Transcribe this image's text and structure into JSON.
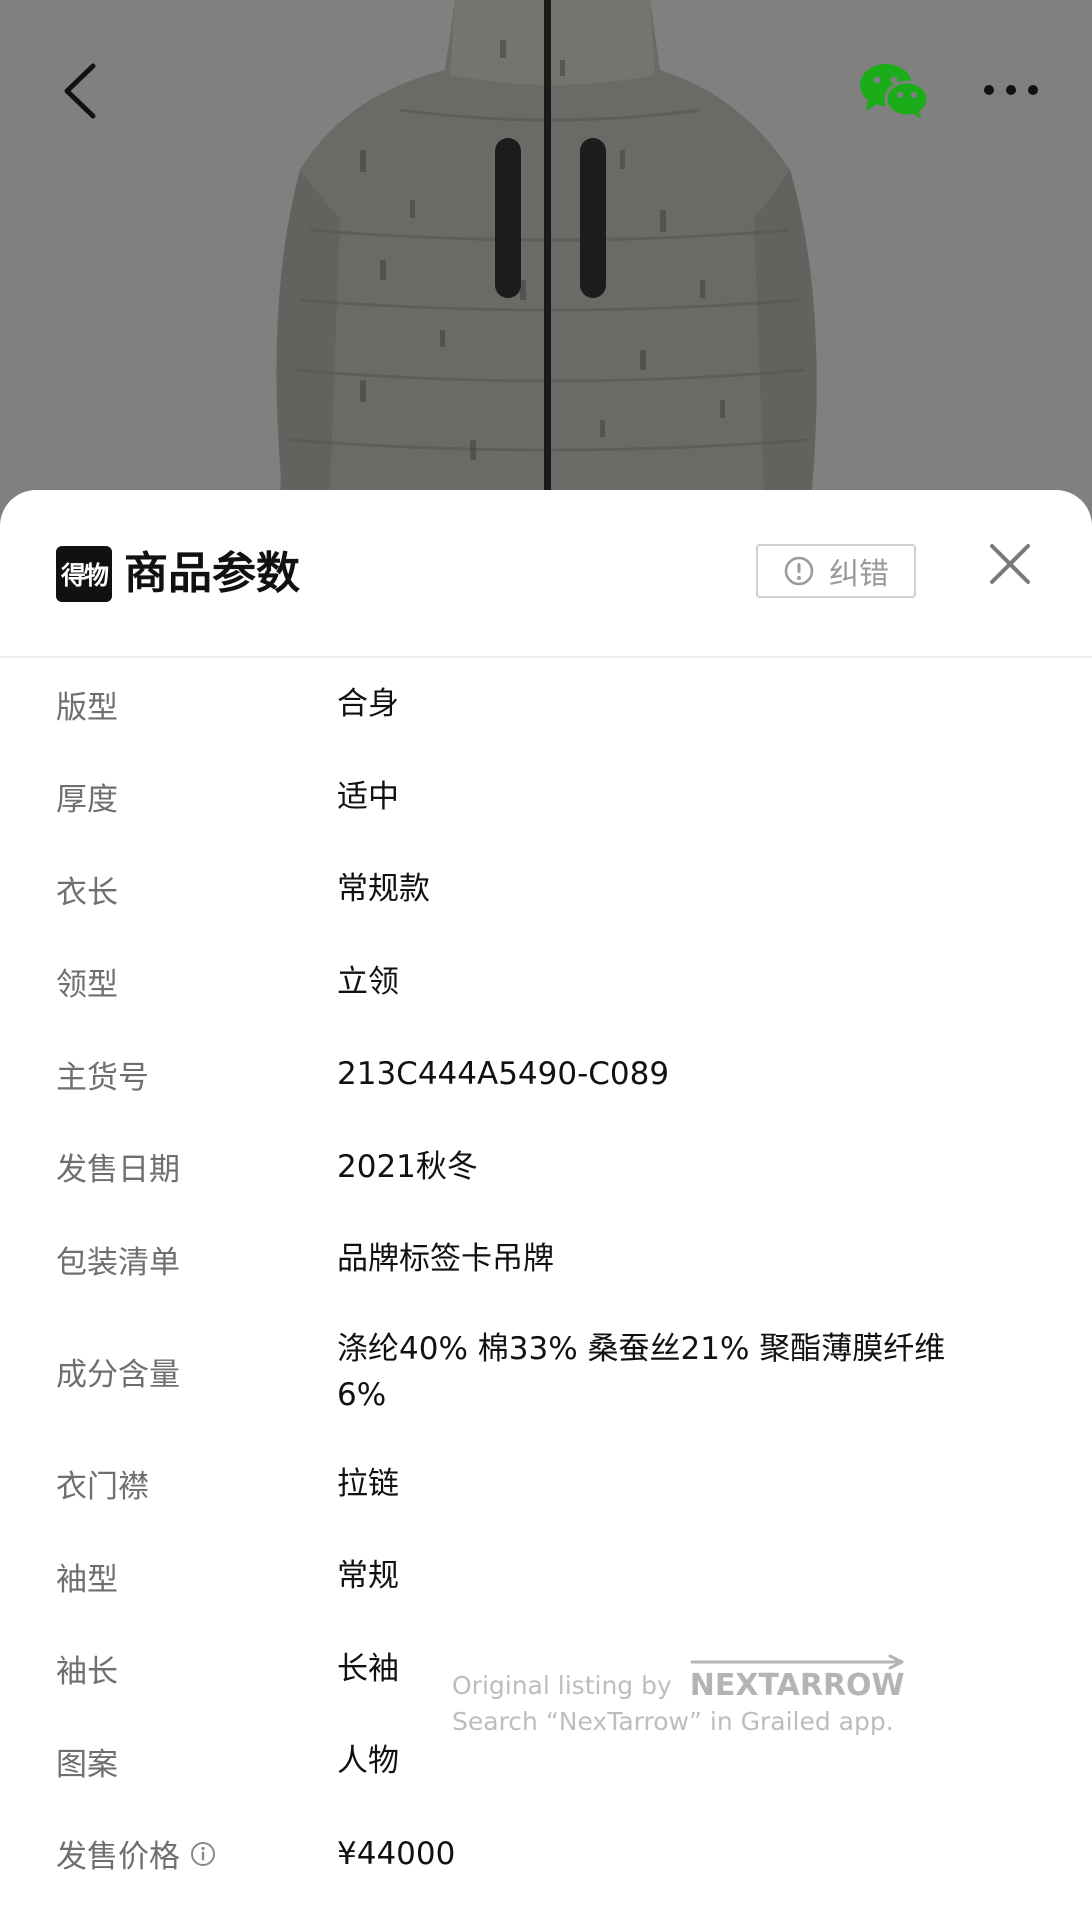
{
  "header": {
    "back_icon": "chevron-left-icon",
    "share_icon": "wechat-icon",
    "more_icon": "more-dots-icon"
  },
  "sheet": {
    "logo_text": "得物",
    "title": "商品参数",
    "report_label": "纠错",
    "report_icon": "alert-circle-icon",
    "close_icon": "close-icon"
  },
  "params": [
    {
      "label": "版型",
      "value": "合身"
    },
    {
      "label": "厚度",
      "value": "适中"
    },
    {
      "label": "衣长",
      "value": "常规款"
    },
    {
      "label": "领型",
      "value": "立领"
    },
    {
      "label": "主货号",
      "value": "213C444A5490-C089"
    },
    {
      "label": "发售日期",
      "value": "2021秋冬"
    },
    {
      "label": "包装清单",
      "value": "品牌标签卡吊牌"
    },
    {
      "label": "成分含量",
      "value": "涤纶40% 棉33% 桑蚕丝21%  聚酯薄膜纤维6%"
    },
    {
      "label": "衣门襟",
      "value": "拉链"
    },
    {
      "label": "袖型",
      "value": "常规"
    },
    {
      "label": "袖长",
      "value": "长袖"
    },
    {
      "label": "图案",
      "value": "人物"
    },
    {
      "label": "发售价格",
      "value": "¥44000"
    }
  ],
  "watermark": {
    "line1": "Original listing by",
    "brand": "NEXTARROW",
    "line2": "Search “NexTarrow” in Grailed app."
  },
  "colors": {
    "backdrop": "#808080",
    "sheet_bg": "#ffffff",
    "label": "#6f6f6f",
    "value": "#111111",
    "wechat_green": "#1aad19"
  }
}
